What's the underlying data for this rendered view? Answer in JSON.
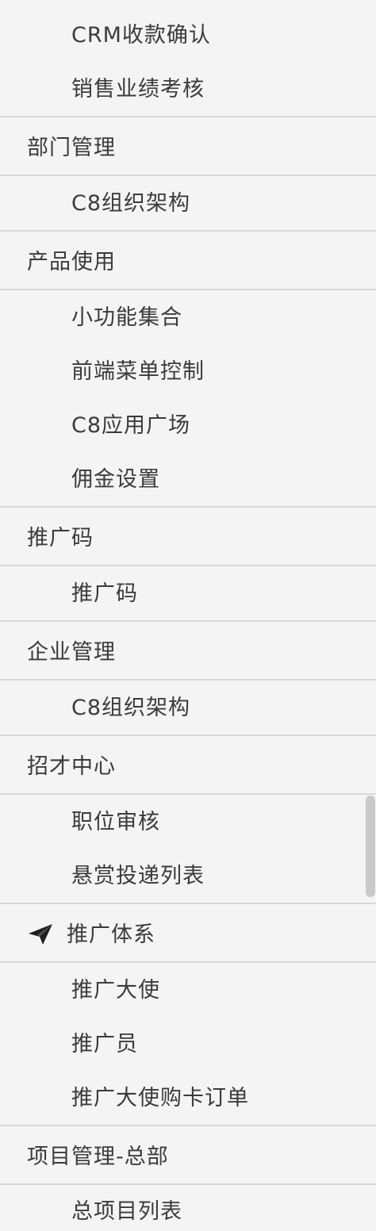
{
  "menu": {
    "crm_confirm": "CRM收款确认",
    "sales_review": "销售业绩考核",
    "dept_mgmt": "部门管理",
    "dept_c8_org": "C8组织架构",
    "product_use": "产品使用",
    "small_features": "小功能集合",
    "frontend_menu": "前端菜单控制",
    "c8_app_square": "C8应用广场",
    "commission_settings": "佣金设置",
    "promo_code_group": "推广码",
    "promo_code": "推广码",
    "enterprise_mgmt": "企业管理",
    "ent_c8_org": "C8组织架构",
    "recruit_center": "招才中心",
    "job_review": "职位审核",
    "bounty_list": "悬赏投递列表",
    "promo_system": "推广体系",
    "promo_ambassador": "推广大使",
    "promoter": "推广员",
    "ambassador_orders": "推广大使购卡订单",
    "project_hq": "项目管理-总部",
    "project_list": "总项目列表"
  },
  "icons": {
    "promo_system_icon": "paper-plane-icon"
  },
  "colors": {
    "background": "#f4f4f4",
    "divider": "#d8d8d8",
    "text": "#3b3b3b"
  }
}
